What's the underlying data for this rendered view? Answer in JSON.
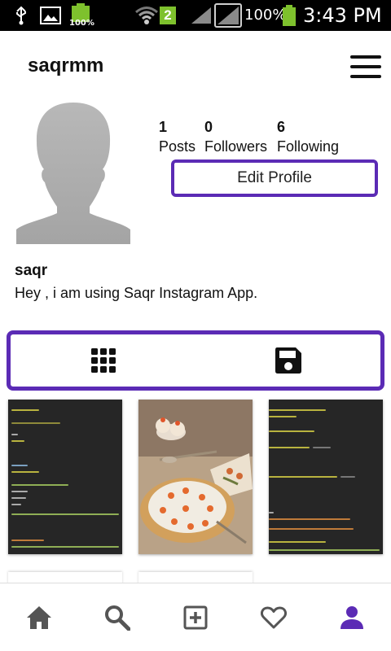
{
  "status_bar": {
    "battery_small_label": "100%",
    "sim_badge": "2",
    "battery_percent": "100%",
    "time": "3:43 PM"
  },
  "profile": {
    "username": "saqrmm",
    "display_name": "saqr",
    "bio": "Hey , i am using Saqr Instagram App.",
    "stats": [
      {
        "value": "1",
        "label": "Posts"
      },
      {
        "value": "0",
        "label": "Followers"
      },
      {
        "value": "6",
        "label": "Following"
      }
    ],
    "edit_button_label": "Edit Profile"
  },
  "tabs": [
    {
      "icon": "grid-icon",
      "active": true
    },
    {
      "icon": "saved-icon",
      "active": false
    }
  ],
  "posts": [
    {
      "kind": "code-screenshot",
      "caption": "post-1"
    },
    {
      "kind": "food-photo",
      "caption": "post-2"
    },
    {
      "kind": "code-screenshot",
      "caption": "post-3"
    }
  ],
  "bottom_nav": [
    {
      "icon": "home-icon",
      "active": false
    },
    {
      "icon": "search-icon",
      "active": false
    },
    {
      "icon": "add-post-icon",
      "active": false
    },
    {
      "icon": "heart-icon",
      "active": false
    },
    {
      "icon": "profile-icon",
      "active": true
    }
  ],
  "colors": {
    "accent": "#5b2bb5",
    "icon_gray": "#555555",
    "status_bar": "#000000"
  }
}
